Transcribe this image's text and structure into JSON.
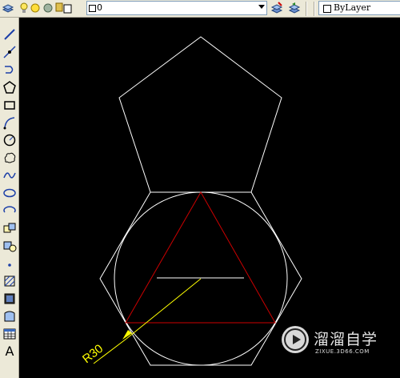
{
  "toolbar": {
    "layer_value": "0",
    "color_value": "ByLayer"
  },
  "left_toolbar": {
    "tools": [
      "line-tool",
      "construction-line-tool",
      "polyline-tool",
      "polygon-tool",
      "rectangle-tool",
      "arc-tool",
      "circle-tool",
      "revision-cloud-tool",
      "spline-tool",
      "ellipse-tool",
      "ellipse-arc-tool",
      "insert-block-tool",
      "make-block-tool",
      "point-tool",
      "hatch-tool",
      "gradient-tool",
      "region-tool",
      "table-tool",
      "multiline-text-tool"
    ],
    "text_tool_label": "A"
  },
  "drawing": {
    "dimension_label": "R30",
    "colors": {
      "white": "#ffffff",
      "red": "#cc0000",
      "yellow": "#ffff00",
      "background": "#000000"
    }
  },
  "watermark": {
    "title": "溜溜自学",
    "url": "ZIXUE.3D66.COM"
  }
}
